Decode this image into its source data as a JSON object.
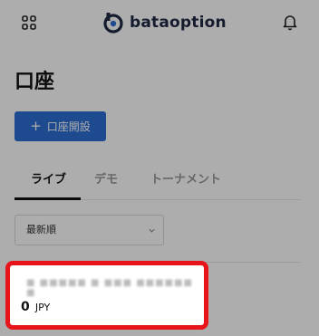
{
  "header": {
    "menu_icon": "grid-icon",
    "logo_text": "bataoption",
    "notification_icon": "bell-icon"
  },
  "page_title": "口座",
  "open_account_button": {
    "icon": "plus-icon",
    "label": "口座開設"
  },
  "tabs": [
    {
      "label": "ライブ",
      "active": true
    },
    {
      "label": "デモ",
      "active": false
    },
    {
      "label": "トーナメント",
      "active": false
    }
  ],
  "sort": {
    "selected": "最新順"
  },
  "account_card": {
    "name": "■ ■■■■■ ■ ■■■ ■■■■■■ ■",
    "balance": "0",
    "currency": "JPY",
    "highlight_color": "#e8141b"
  },
  "colors": {
    "accent": "#2d6fd4",
    "highlight": "#e8141b"
  }
}
